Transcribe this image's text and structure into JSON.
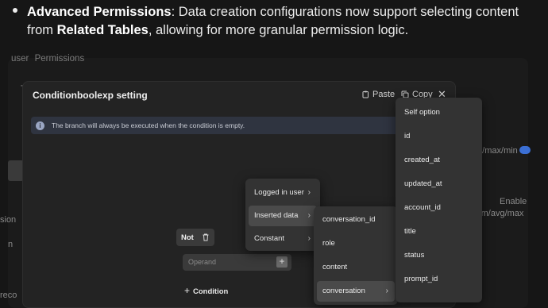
{
  "bullet": {
    "title": "Advanced Permissions",
    "text_part1": ": Data creation configurations now support selecting content from",
    "bold_part2": "Related Tables",
    "text_part3": ", allowing for more granular permission logic."
  },
  "background": {
    "tab_user": "user",
    "tab_permissions": "Permissions",
    "t_letter": "T",
    "agg1": "/g/max/min",
    "enable": "Enable",
    "agg2": "sum/avg/max",
    "sion": "sion",
    "n": "n",
    "reco": "reco"
  },
  "dialog": {
    "title": "Conditionboolexp setting",
    "paste_label": "Paste",
    "copy_label": "Copy",
    "info_text": "The branch will always be executed when the condition is empty.",
    "not_label": "Not",
    "operand_placeholder": "Operand",
    "add_condition_label": "Condition"
  },
  "menu_level1": [
    {
      "label": "Logged in user",
      "has_submenu": true
    },
    {
      "label": "Inserted data",
      "has_submenu": true,
      "active": true
    },
    {
      "label": "Constant",
      "has_submenu": true
    }
  ],
  "menu_level2": [
    {
      "label": "conversation_id"
    },
    {
      "label": "role"
    },
    {
      "label": "content"
    },
    {
      "label": "conversation",
      "has_submenu": true,
      "active": true
    }
  ],
  "menu_level3": [
    {
      "label": "Self option"
    },
    {
      "label": "id"
    },
    {
      "label": "created_at"
    },
    {
      "label": "updated_at"
    },
    {
      "label": "account_id"
    },
    {
      "label": "title"
    },
    {
      "label": "status"
    },
    {
      "label": "prompt_id"
    }
  ],
  "colors": {
    "page_bg": "#161616",
    "dialog_bg": "#232323",
    "menu_bg": "#333333",
    "accent_toggle": "#3b6fd4",
    "info_bar": "#2f3440"
  }
}
